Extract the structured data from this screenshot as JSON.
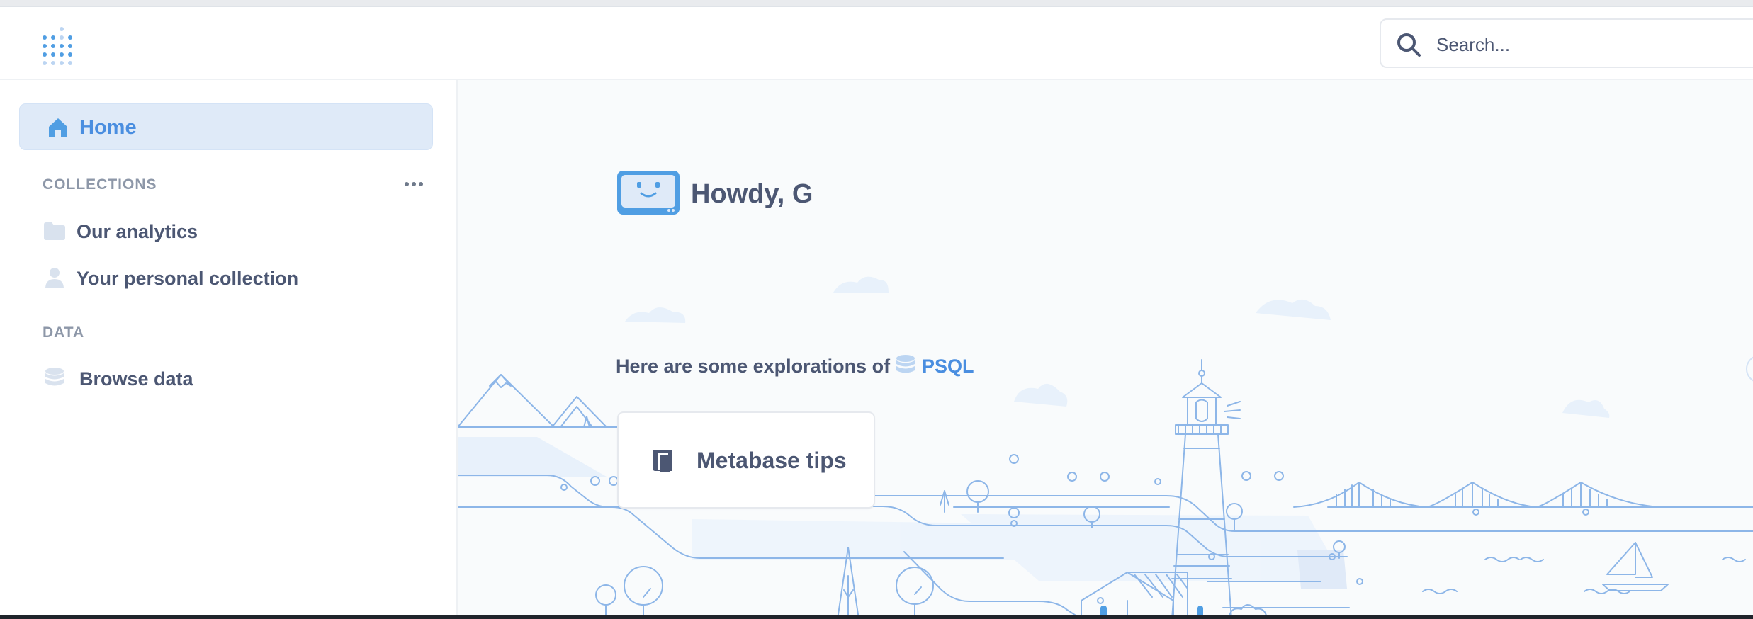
{
  "header": {
    "logo_icon": "metabase-logo",
    "search": {
      "placeholder": "Search...",
      "icon": "search-icon"
    }
  },
  "sidebar": {
    "home": {
      "label": "Home",
      "icon": "home-icon"
    },
    "collections_title": "COLLECTIONS",
    "more_icon": "more-horizontal-icon",
    "collections": [
      {
        "label": "Our analytics",
        "icon": "folder-icon"
      },
      {
        "label": "Your personal collection",
        "icon": "person-icon"
      }
    ],
    "data_title": "DATA",
    "data_items": [
      {
        "label": "Browse data",
        "icon": "database-icon"
      }
    ]
  },
  "main": {
    "greeting": "Howdy, G",
    "greeting_icon": "bot-face-icon",
    "explorations": {
      "prefix": "Here are some explorations of",
      "database": "PSQL",
      "database_icon": "database-icon"
    },
    "tip_card": {
      "label": "Metabase tips",
      "icon": "book-icon"
    }
  },
  "colors": {
    "accent": "#509ee3",
    "text": "#4c5773",
    "muted": "#8d97a8",
    "active_bg": "#dfeaf8",
    "line_art": "#8db6e8"
  }
}
